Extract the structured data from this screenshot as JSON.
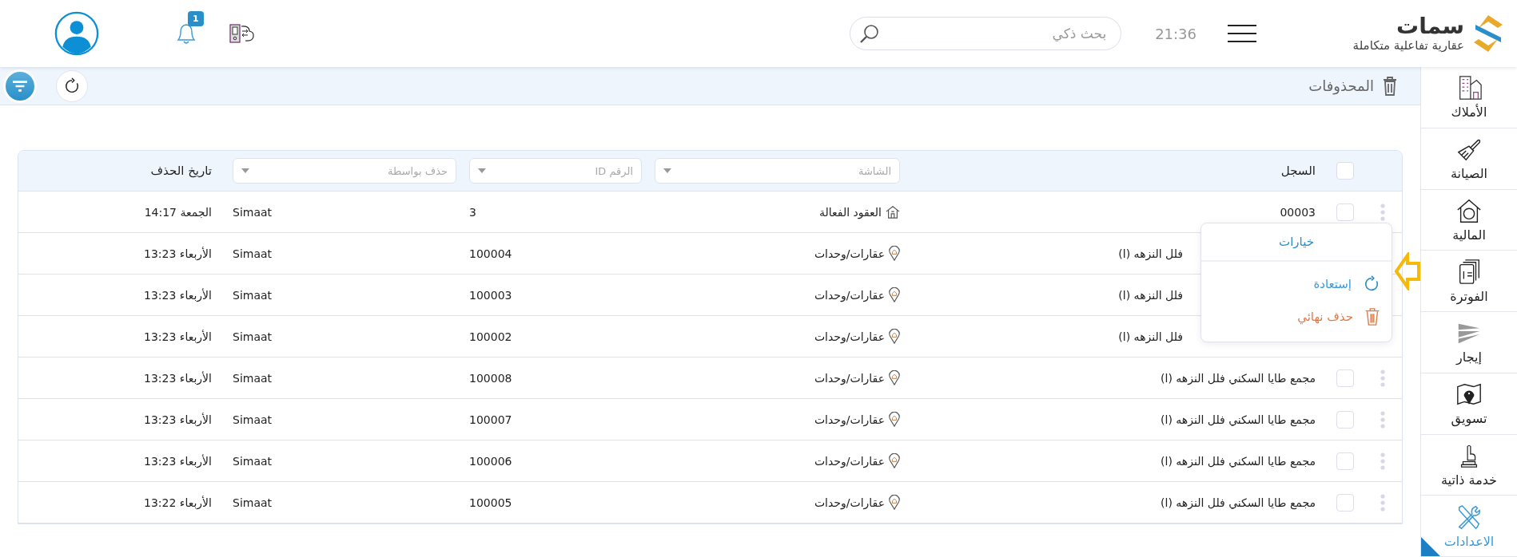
{
  "brand": {
    "name": "سمات",
    "tagline": "عقارية تفاعلية متكاملة"
  },
  "header": {
    "time": "21:36",
    "search": {
      "placeholder": "بحث ذكي"
    },
    "notifications": {
      "count": "1"
    }
  },
  "sidebar": {
    "items": [
      {
        "label": "الأملاك",
        "selected": false
      },
      {
        "label": "الصيانة",
        "selected": false
      },
      {
        "label": "المالية",
        "selected": false
      },
      {
        "label": "الفوترة",
        "selected": false
      },
      {
        "label": "إيجار",
        "selected": false
      },
      {
        "label": "تسويق",
        "selected": false
      },
      {
        "label": "خدمة ذاتية",
        "selected": false
      },
      {
        "label": "الاعدادات",
        "selected": true
      }
    ]
  },
  "page": {
    "title": "المحذوفات"
  },
  "table": {
    "header_checkbox": {
      "checked": false
    },
    "columns": [
      {
        "kind": "label",
        "label": "السجل"
      },
      {
        "kind": "filter",
        "placeholder": "الشاشة"
      },
      {
        "kind": "filter",
        "placeholder": "الرقم ID"
      },
      {
        "kind": "filter",
        "placeholder": "حذف بواسطة"
      },
      {
        "kind": "label",
        "label": "تاريخ الحذف"
      }
    ],
    "rows": [
      {
        "kind": "contract",
        "record": "00003",
        "screen": "العقود الفعالة",
        "id": "3",
        "deleted_by": "Simaat",
        "date": "الجمعة 14:17",
        "checked": false,
        "menu": true
      },
      {
        "kind": "unit",
        "record": "فلل النزهه (ا)",
        "screen": "عقارات/وحدات",
        "id": "100004",
        "deleted_by": "Simaat",
        "date": "الأربعاء 13:23"
      },
      {
        "kind": "unit",
        "record": "فلل النزهه (ا)",
        "screen": "عقارات/وحدات",
        "id": "100003",
        "deleted_by": "Simaat",
        "date": "الأربعاء 13:23"
      },
      {
        "kind": "unit",
        "record": "فلل النزهه (ا)",
        "screen": "عقارات/وحدات",
        "id": "100002",
        "deleted_by": "Simaat",
        "date": "الأربعاء 13:23"
      },
      {
        "kind": "unit",
        "record": "مجمع طايا السكني فلل النزهه (ا)",
        "screen": "عقارات/وحدات",
        "id": "100008",
        "deleted_by": "Simaat",
        "date": "الأربعاء 13:23",
        "checked": false,
        "menu": true
      },
      {
        "kind": "unit",
        "record": "مجمع طايا السكني فلل النزهه (ا)",
        "screen": "عقارات/وحدات",
        "id": "100007",
        "deleted_by": "Simaat",
        "date": "الأربعاء 13:23",
        "checked": false,
        "menu": true
      },
      {
        "kind": "unit",
        "record": "مجمع طايا السكني فلل النزهه (ا)",
        "screen": "عقارات/وحدات",
        "id": "100006",
        "deleted_by": "Simaat",
        "date": "الأربعاء 13:23",
        "checked": false,
        "menu": true
      },
      {
        "kind": "unit",
        "record": "مجمع طايا السكني فلل النزهه (ا)",
        "screen": "عقارات/وحدات",
        "id": "100005",
        "deleted_by": "Simaat",
        "date": "الأربعاء 13:22",
        "checked": false,
        "menu": true
      }
    ]
  },
  "context_menu": {
    "title": "خيارات",
    "pointer": true,
    "items": [
      {
        "kind": "restore",
        "label": "إستعادة"
      },
      {
        "kind": "delete",
        "label": "حذف نهائي"
      }
    ]
  }
}
